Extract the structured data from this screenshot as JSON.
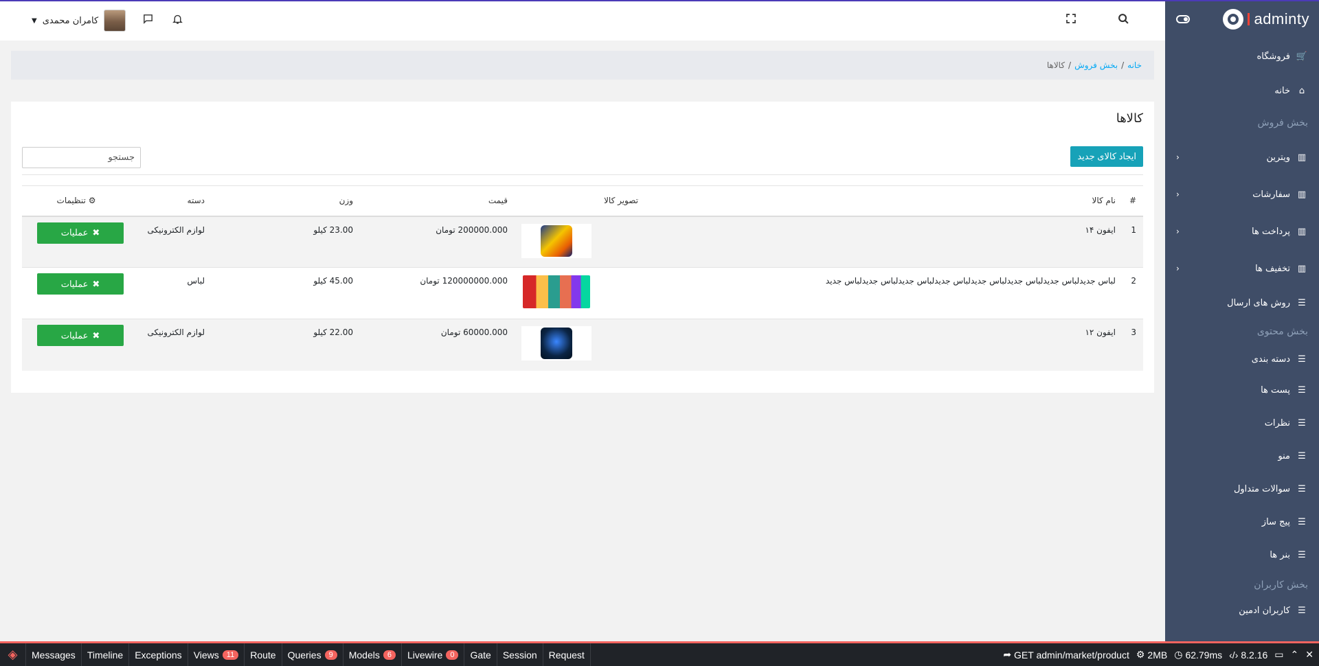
{
  "sidebar": {
    "brand": "adminty",
    "store_label": "فروشگاه",
    "items": [
      {
        "type": "item",
        "label": "خانه",
        "icon": "home-icon"
      },
      {
        "type": "caption",
        "label": "بخش فروش"
      },
      {
        "type": "item",
        "label": "ویترین",
        "icon": "chart-icon",
        "expandable": true
      },
      {
        "type": "item",
        "label": "سفارشات",
        "icon": "chart-icon",
        "expandable": true
      },
      {
        "type": "item",
        "label": "پرداخت ها",
        "icon": "chart-icon",
        "expandable": true
      },
      {
        "type": "item",
        "label": "تخفیف ها",
        "icon": "chart-icon",
        "expandable": true
      },
      {
        "type": "item",
        "label": "روش های ارسال",
        "icon": "list-icon"
      },
      {
        "type": "caption",
        "label": "بخش محتوی"
      },
      {
        "type": "item",
        "label": "دسته بندی",
        "icon": "list-icon"
      },
      {
        "type": "item",
        "label": "پست ها",
        "icon": "list-icon"
      },
      {
        "type": "item",
        "label": "نظرات",
        "icon": "list-icon"
      },
      {
        "type": "item",
        "label": "منو",
        "icon": "list-icon"
      },
      {
        "type": "item",
        "label": "سوالات متداول",
        "icon": "list-icon"
      },
      {
        "type": "item",
        "label": "پیج ساز",
        "icon": "list-icon"
      },
      {
        "type": "item",
        "label": "بنر ها",
        "icon": "list-icon"
      },
      {
        "type": "caption",
        "label": "بخش کاربران"
      },
      {
        "type": "item",
        "label": "کاربران ادمین",
        "icon": "list-icon"
      }
    ]
  },
  "header": {
    "user_name": "کامران محمدی"
  },
  "breadcrumb": {
    "home": "خانه",
    "sales": "بخش فروش",
    "current": "کالاها",
    "sep": "/"
  },
  "card": {
    "title": "کالاها",
    "create_button": "ایجاد کالای جدید",
    "search_placeholder": "جستجو"
  },
  "table": {
    "headers": {
      "num": "#",
      "name": "نام کالا",
      "image": "تصویر کالا",
      "price": "قیمت",
      "weight": "وزن",
      "category": "دسته",
      "settings": "تنظیمات"
    },
    "rows": [
      {
        "num": "1",
        "name": "ایفون ۱۴",
        "price": "200000.000 تومان",
        "weight": "23.00 کیلو",
        "category": "لوازم الکترونیکی",
        "ops": "عملیات"
      },
      {
        "num": "2",
        "name": "لباس جدیدلباس جدیدلباس جدیدلباس جدیدلباس جدیدلباس جدیدلباس جدیدلباس جدید",
        "price": "120000000.000 تومان",
        "weight": "45.00 کیلو",
        "category": "لباس",
        "ops": "عملیات"
      },
      {
        "num": "3",
        "name": "ایفون ۱۲",
        "price": "60000.000 تومان",
        "weight": "22.00 کیلو",
        "category": "لوازم الکترونیکی",
        "ops": "عملیات"
      }
    ]
  },
  "debugbar": {
    "tabs": [
      {
        "label": "Messages"
      },
      {
        "label": "Timeline"
      },
      {
        "label": "Exceptions"
      },
      {
        "label": "Views",
        "count": "11"
      },
      {
        "label": "Route"
      },
      {
        "label": "Queries",
        "count": "9"
      },
      {
        "label": "Models",
        "count": "6"
      },
      {
        "label": "Livewire",
        "count": "0"
      },
      {
        "label": "Gate"
      },
      {
        "label": "Session"
      },
      {
        "label": "Request"
      }
    ],
    "route": "GET admin/market/product",
    "memory": "2MB",
    "time": "62.79ms",
    "php": "8.2.16"
  },
  "colors": {
    "sidebar_bg": "#3f4d67",
    "accent_blue": "#04a9f5",
    "create_btn": "#17a2b8",
    "ops_btn": "#28a745",
    "debug_red": "#f4645f"
  }
}
